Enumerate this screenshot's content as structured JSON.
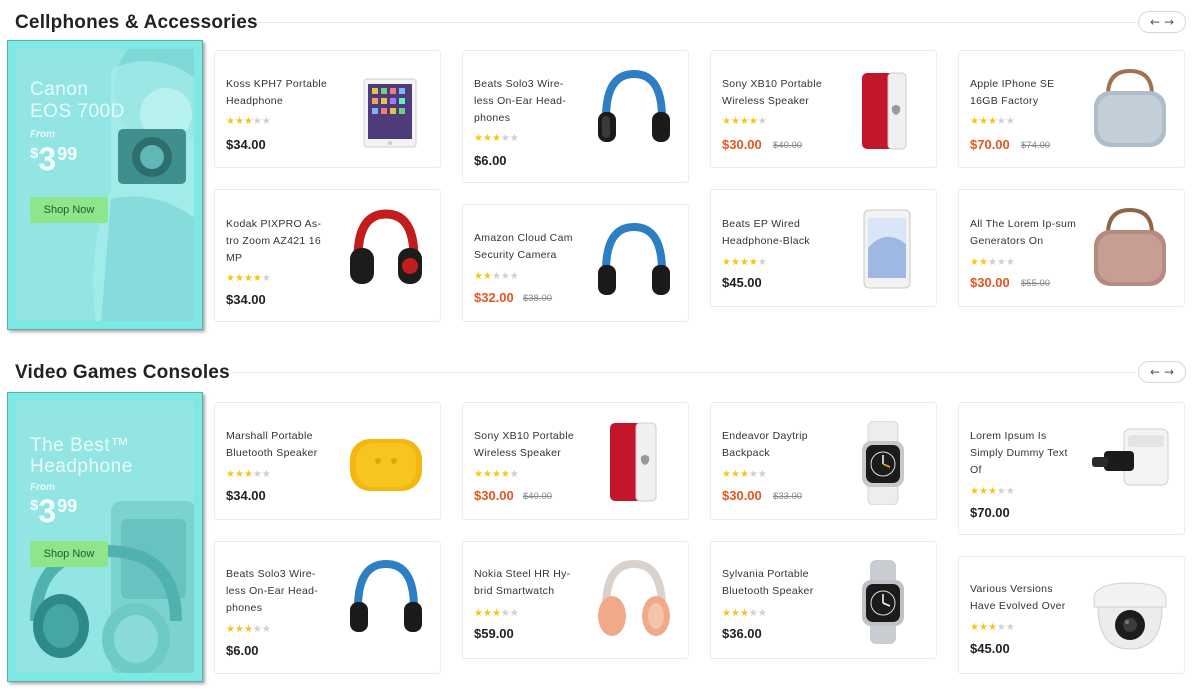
{
  "sections": [
    {
      "title": "Cellphones & Accessories",
      "banner": {
        "line1": "Canon",
        "line2": "EOS 700D",
        "from": "From",
        "currency": "$",
        "price_main": "3",
        "price_cents": "99",
        "button": "Shop Now"
      },
      "products": [
        {
          "name": "Koss KPH7 Portable Headphone",
          "rating": 3,
          "price": "$34.00",
          "old_price": "",
          "image": "tablet"
        },
        {
          "name": "Beats Solo3 Wire-less On-Ear Head-phones",
          "rating": 3,
          "price": "$6.00",
          "old_price": "",
          "image": "headphone-blue"
        },
        {
          "name": "Sony XB10 Portable Wireless Speaker",
          "rating": 3.5,
          "price": "$30.00",
          "old_price": "$40.00",
          "image": "phone-red"
        },
        {
          "name": "Apple IPhone SE 16GB Factory",
          "rating": 2.5,
          "price": "$70.00",
          "old_price": "$74.00",
          "image": "speaker-gray"
        },
        {
          "name": "Kodak PIXPRO As-tro Zoom AZ421 16 MP",
          "rating": 4,
          "price": "$34.00",
          "old_price": "",
          "image": "headphone-red"
        },
        {
          "name": "Amazon Cloud Cam Security Camera",
          "rating": 2,
          "price": "$32.00",
          "old_price": "$38.00",
          "image": "headphone-blue"
        },
        {
          "name": "Beats EP Wired Headphone-Black",
          "rating": 4,
          "price": "$45.00",
          "old_price": "",
          "image": "phone-white"
        },
        {
          "name": "All The Lorem Ip-sum Generators On",
          "rating": 2,
          "price": "$30.00",
          "old_price": "$55.00",
          "image": "speaker-pink"
        }
      ]
    },
    {
      "title": "Video Games Consoles",
      "banner": {
        "line1": "The Best™",
        "line2": "Headphone",
        "from": "From",
        "currency": "$",
        "price_main": "3",
        "price_cents": "99",
        "button": "Shop Now"
      },
      "products": [
        {
          "name": "Marshall Portable Bluetooth Speaker",
          "rating": 3,
          "price": "$34.00",
          "old_price": "",
          "image": "speaker-yellow"
        },
        {
          "name": "Sony XB10 Portable Wireless Speaker",
          "rating": 3.5,
          "price": "$30.00",
          "old_price": "$40.00",
          "image": "phone-red"
        },
        {
          "name": "Endeavor Daytrip Backpack",
          "rating": 3,
          "price": "$30.00",
          "old_price": "$33.00",
          "image": "watch-white"
        },
        {
          "name": "Lorem Ipsum Is Simply Dummy Text Of",
          "rating": 2.5,
          "price": "$70.00",
          "old_price": "",
          "image": "vr-headset"
        },
        {
          "name": "Beats Solo3 Wire-less On-Ear Head-phones",
          "rating": 3,
          "price": "$6.00",
          "old_price": "",
          "image": "headphone-blue"
        },
        {
          "name": "Nokia Steel HR Hy-brid Smartwatch",
          "rating": 3,
          "price": "$59.00",
          "old_price": "",
          "image": "headphone-peach"
        },
        {
          "name": "Sylvania Portable Bluetooth Speaker",
          "rating": 3,
          "price": "$36.00",
          "old_price": "",
          "image": "watch-gray"
        },
        {
          "name": "Various Versions Have Evolved Over",
          "rating": 3,
          "price": "$45.00",
          "old_price": "",
          "image": "camera-dome"
        }
      ]
    }
  ],
  "colors": {
    "sale": "#e8561e",
    "star": "#f5c518",
    "banner": "#8fe6e4",
    "shop_button": "#8ee58a"
  }
}
